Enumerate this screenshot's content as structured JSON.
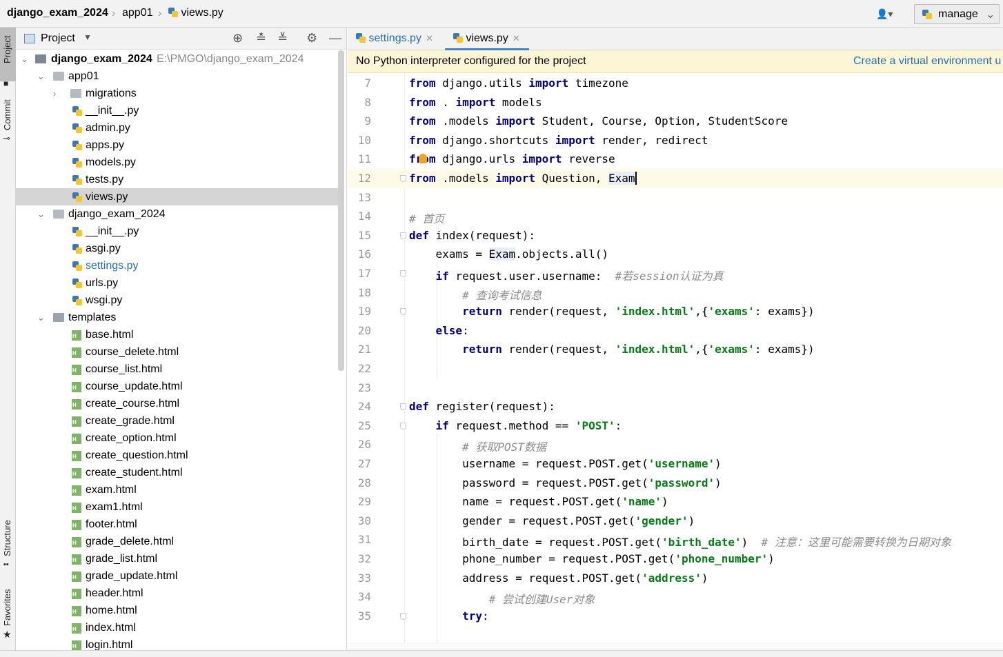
{
  "breadcrumb": {
    "project": "django_exam_2024",
    "folder": "app01",
    "file": "views.py"
  },
  "toolbar": {
    "run_config": "manage"
  },
  "left_strip": {
    "project": "Project",
    "commit": "Commit",
    "structure": "Structure",
    "favorites": "Favorites"
  },
  "project_panel": {
    "title": "Project"
  },
  "tree": {
    "root": {
      "name": "django_exam_2024",
      "path": "E:\\PMGO\\django_exam_2024"
    },
    "items": [
      {
        "label": "app01"
      },
      {
        "label": "migrations"
      },
      {
        "label": "__init__.py"
      },
      {
        "label": "admin.py"
      },
      {
        "label": "apps.py"
      },
      {
        "label": "models.py"
      },
      {
        "label": "tests.py"
      },
      {
        "label": "views.py"
      },
      {
        "label": "django_exam_2024"
      },
      {
        "label": "__init__.py"
      },
      {
        "label": "asgi.py"
      },
      {
        "label": "settings.py"
      },
      {
        "label": "urls.py"
      },
      {
        "label": "wsgi.py"
      },
      {
        "label": "templates"
      },
      {
        "label": "base.html"
      },
      {
        "label": "course_delete.html"
      },
      {
        "label": "course_list.html"
      },
      {
        "label": "course_update.html"
      },
      {
        "label": "create_course.html"
      },
      {
        "label": "create_grade.html"
      },
      {
        "label": "create_option.html"
      },
      {
        "label": "create_question.html"
      },
      {
        "label": "create_student.html"
      },
      {
        "label": "exam.html"
      },
      {
        "label": "exam1.html"
      },
      {
        "label": "footer.html"
      },
      {
        "label": "grade_delete.html"
      },
      {
        "label": "grade_list.html"
      },
      {
        "label": "grade_update.html"
      },
      {
        "label": "header.html"
      },
      {
        "label": "home.html"
      },
      {
        "label": "index.html"
      },
      {
        "label": "login.html"
      }
    ]
  },
  "editor": {
    "tabs": [
      {
        "label": "settings.py"
      },
      {
        "label": "views.py"
      }
    ],
    "notification": {
      "message": "No Python interpreter configured for the project",
      "action": "Create a virtual environment u"
    },
    "line_numbers": [
      "7",
      "8",
      "9",
      "10",
      "11",
      "12",
      "13",
      "14",
      "15",
      "16",
      "17",
      "18",
      "19",
      "20",
      "21",
      "22",
      "23",
      "24",
      "25",
      "26",
      "27",
      "28",
      "29",
      "30",
      "31",
      "32",
      "33",
      "34",
      "35"
    ],
    "code": {
      "l7": [
        "from",
        " django.utils ",
        "import",
        " timezone"
      ],
      "l8": [
        "from",
        " . ",
        "import",
        " models"
      ],
      "l9": [
        "from",
        " .models ",
        "import",
        " Student, Course, Option, StudentScore"
      ],
      "l10": [
        "from",
        " django.shortcuts ",
        "import",
        " render, redirect"
      ],
      "l11": [
        "from",
        " django.urls ",
        "import",
        " reverse"
      ],
      "l12": [
        "from",
        " .models ",
        "import",
        " Question, ",
        "Exam"
      ],
      "l14": "# 首页",
      "l15": [
        "def",
        " index(request):"
      ],
      "l16": [
        "    exams = ",
        "Exam",
        ".objects.all()"
      ],
      "l17": [
        "    ",
        "if",
        " request.user.username:  ",
        "#若session认证为真"
      ],
      "l18": "        # 查询考试信息",
      "l19": [
        "        ",
        "return",
        " render(request, ",
        "'index.html'",
        ",{",
        "'exams'",
        ": exams})"
      ],
      "l20": [
        "    ",
        "else",
        ":"
      ],
      "l21": [
        "        ",
        "return",
        " render(request, ",
        "'index.html'",
        ",{",
        "'exams'",
        ": exams})"
      ],
      "l24": [
        "def",
        " register(request):"
      ],
      "l25": [
        "    ",
        "if",
        " request.method == ",
        "'POST'",
        ":"
      ],
      "l26": "        # 获取POST数据",
      "l27": [
        "        username = request.POST.get(",
        "'username'",
        ")"
      ],
      "l28": [
        "        password = request.POST.get(",
        "'password'",
        ")"
      ],
      "l29": [
        "        name = request.POST.get(",
        "'name'",
        ")"
      ],
      "l30": [
        "        gender = request.POST.get(",
        "'gender'",
        ")"
      ],
      "l31": [
        "        birth_date = request.POST.get(",
        "'birth_date'",
        ")  ",
        "# 注意：这里可能需要转换为日期对象"
      ],
      "l32": [
        "        phone_number = request.POST.get(",
        "'phone_number'",
        ")"
      ],
      "l33": [
        "        address = request.POST.get(",
        "'address'",
        ")"
      ],
      "l34": "            # 尝试创建User对象",
      "l35": [
        "        ",
        "try",
        ":"
      ]
    }
  }
}
